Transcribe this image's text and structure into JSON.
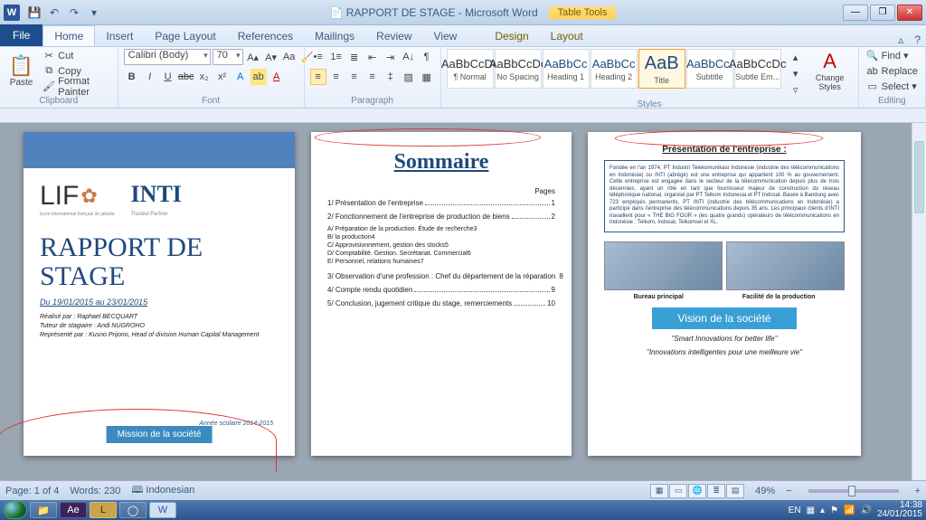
{
  "window": {
    "app_title": "RAPPORT DE STAGE - Microsoft Word",
    "context_tab": "Table Tools"
  },
  "qat": [
    "save",
    "undo",
    "redo"
  ],
  "tabs": {
    "file": "File",
    "items": [
      "Home",
      "Insert",
      "Page Layout",
      "References",
      "Mailings",
      "Review",
      "View"
    ],
    "context_items": [
      "Design",
      "Layout"
    ],
    "active": "Home"
  },
  "ribbon": {
    "clipboard": {
      "label": "Clipboard",
      "paste": "Paste",
      "cut": "Cut",
      "copy": "Copy",
      "format_painter": "Format Painter"
    },
    "font": {
      "label": "Font",
      "name": "Calibri (Body)",
      "size": "70"
    },
    "paragraph": {
      "label": "Paragraph"
    },
    "styles": {
      "label": "Styles",
      "items": [
        {
          "preview": "AaBbCcDc",
          "label": "¶ Normal"
        },
        {
          "preview": "AaBbCcDc",
          "label": "No Spacing"
        },
        {
          "preview": "AaBbCc",
          "label": "Heading 1"
        },
        {
          "preview": "AaBbCc",
          "label": "Heading 2"
        },
        {
          "preview": "AaB",
          "label": "Title"
        },
        {
          "preview": "AaBbCc.",
          "label": "Subtitle"
        },
        {
          "preview": "AaBbCcDc",
          "label": "Subtle Em..."
        }
      ],
      "selected": 4,
      "change_styles": "Change Styles"
    },
    "editing": {
      "label": "Editing",
      "find": "Find",
      "replace": "Replace",
      "select": "Select"
    }
  },
  "document": {
    "page1": {
      "logo1_main": "LIF",
      "logo1_sub": "lycée international français de jakarta",
      "logo2_main": "INTI",
      "logo2_sub": "Trusted Partner",
      "title": "RAPPORT DE STAGE",
      "dates": "Du 19/01/2015 au 23/01/2015",
      "meta1": "Réalisé par : Raphael BECQUART",
      "meta2": "Tuteur de stagiaire : Andi NUGROHO",
      "meta3": "Représenté par : Kusno Prijono, Head of division Human Capital Management",
      "annee": "Année scolaire 2014-2015",
      "bluebar": "Mission de la société"
    },
    "page2": {
      "title": "Sommaire",
      "pages_header": "Pages",
      "toc": [
        {
          "t": "1/ Présentation de l'entreprise",
          "n": "1"
        },
        {
          "t": "2/ Fonctionnement de l'entreprise de production de biens",
          "n": "2"
        }
      ],
      "toc_sub": [
        {
          "t": "A/ Préparation de la production. Étude de recherche",
          "n": "3"
        },
        {
          "t": "B/ la production",
          "n": "4"
        },
        {
          "t": "C/ Approvisionnement, gestion des stocks",
          "n": "5"
        },
        {
          "t": "D/ Comptabilité. Gestion. Secrétariat. Commercial",
          "n": "6"
        },
        {
          "t": "E/ Personnel, relations humaines",
          "n": "7"
        }
      ],
      "toc2": [
        {
          "t": "3/ Observation d'une profession : Chef du département de la réparation",
          "n": "8"
        },
        {
          "t": "4/ Compte rendu quotidien",
          "n": "9"
        },
        {
          "t": "5/ Conclusion, jugement critique du stage, remerciements",
          "n": "10"
        }
      ]
    },
    "page3": {
      "heading": "Présentation de l'entreprise :",
      "box_text": "Fondée en l'an 1974, PT Industri Telekomunikasi Indonesie (industrie des télécommunications en Indonésie) ou INTI (abrégé) est une entreprise qui appartient 100 % au gouvernement. Cette entreprise est engagée dans le secteur de la télécommunication depuis plus de trois décennies, ayant un rôle en tant que fournisseur majeur de construction du réseau téléphonique national, organisé par PT Telkom Indonesia et PT Indosat. Basée à Bandung avec 723 employés permanents, PT INTI (industrie des télécommunications en Indonésie) a participé dans l'entreprise des télécommunications depuis 35 ans. Les principaux clients d'INTI travaillent pour « THE BIG FOUR » (les quatre grands) opérateurs de télécommunications en Indonésie ; Telkom, Indosat, Telkomsel et XL.",
      "caption1": "Bureau principal",
      "caption2": "Facilité de la production",
      "vision_title": "Vision de la société",
      "slogan_en": "''Smart Innovations for better life''",
      "slogan_fr": "''Innovations intelligentes pour une meilleure vie''"
    }
  },
  "statusbar": {
    "page": "Page: 1 of 4",
    "words": "Words: 230",
    "language": "Indonesian",
    "zoom": "49%"
  },
  "taskbar": {
    "lang": "EN",
    "time": "14:38",
    "date": "24/01/2015"
  }
}
